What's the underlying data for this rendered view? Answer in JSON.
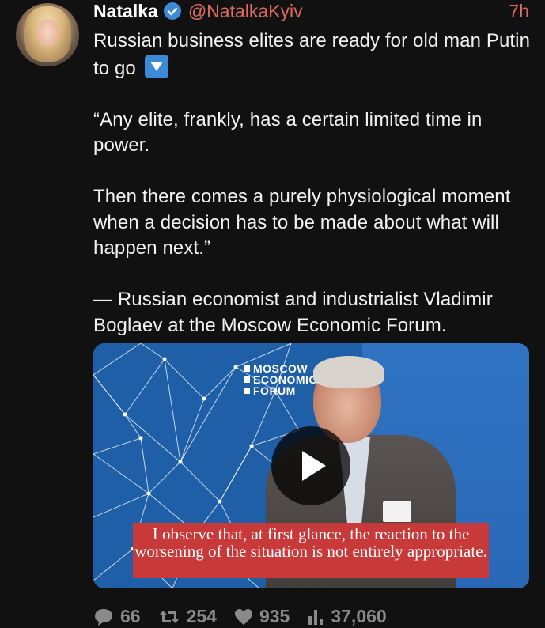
{
  "tweet": {
    "author_name": "Natalka",
    "handle": "@NatalkaKyiv",
    "time": "7h",
    "paragraphs": [
      "Russian business elites are ready for old man Putin to go",
      "“Any elite, frankly, has a certain limited time in power.",
      "Then there comes a purely physiological moment when a decision has to be made about what will happen next.”",
      "— Russian economist and industrialist Vladimir Boglaev at the Moscow Economic Forum."
    ],
    "emoji": "down-arrow-button-emoji"
  },
  "media": {
    "banner_logo_lines": [
      "MOSCOW",
      "ECONOMIC",
      "FORUM"
    ],
    "caption": "I observe that, at first glance, the reaction to the worsening of the situation is not entirely appropriate.",
    "play_icon": "play-icon"
  },
  "actions": {
    "replies": "66",
    "retweets": "254",
    "likes": "935",
    "views": "37,060"
  },
  "colors": {
    "background": "#111111",
    "accent": "#e06a62",
    "verified": "#3d8ad8",
    "caption_bg": "#c83a3a",
    "muted": "#8a8a8a"
  }
}
